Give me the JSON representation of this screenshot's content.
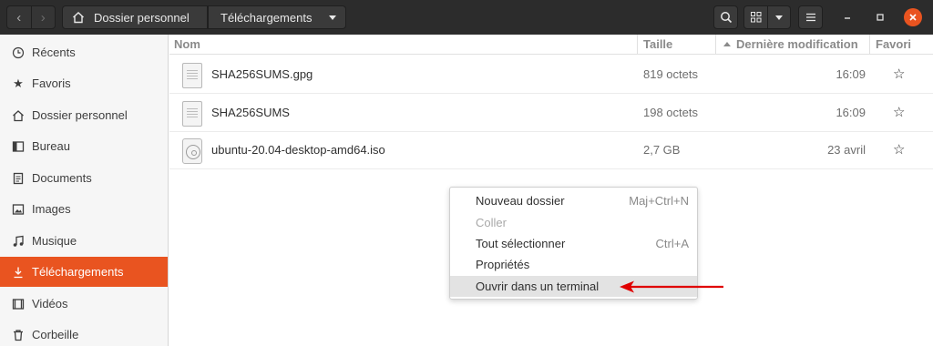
{
  "header": {
    "path_home": "Dossier personnel",
    "path_current": "Téléchargements"
  },
  "sidebar": {
    "items": [
      {
        "label": "Récents",
        "icon": "clock-icon"
      },
      {
        "label": "Favoris",
        "icon": "star-icon"
      },
      {
        "label": "Dossier personnel",
        "icon": "home-icon"
      },
      {
        "label": "Bureau",
        "icon": "desktop-icon"
      },
      {
        "label": "Documents",
        "icon": "document-icon"
      },
      {
        "label": "Images",
        "icon": "image-icon"
      },
      {
        "label": "Musique",
        "icon": "music-icon"
      },
      {
        "label": "Téléchargements",
        "icon": "download-icon"
      },
      {
        "label": "Vidéos",
        "icon": "video-icon"
      },
      {
        "label": "Corbeille",
        "icon": "trash-icon"
      }
    ],
    "active": "Téléchargements"
  },
  "list": {
    "columns": {
      "name": "Nom",
      "size": "Taille",
      "modified": "Dernière modification",
      "favorite": "Favori"
    },
    "rows": [
      {
        "name": "SHA256SUMS.gpg",
        "size": "819 octets",
        "modified": "16:09",
        "icon": "text-file-icon"
      },
      {
        "name": "SHA256SUMS",
        "size": "198 octets",
        "modified": "16:09",
        "icon": "text-file-icon"
      },
      {
        "name": "ubuntu-20.04-desktop-amd64.iso",
        "size": "2,7 GB",
        "modified": "23 avril",
        "icon": "disc-image-icon"
      }
    ]
  },
  "context_menu": {
    "items": [
      {
        "label": "Nouveau dossier",
        "shortcut": "Maj+Ctrl+N"
      },
      {
        "label": "Coller",
        "shortcut": ""
      },
      {
        "label": "Tout sélectionner",
        "shortcut": "Ctrl+A"
      },
      {
        "label": "Propriétés",
        "shortcut": ""
      },
      {
        "label": "Ouvrir dans un terminal",
        "shortcut": ""
      }
    ]
  },
  "colors": {
    "accent": "#e95420",
    "headerbar": "#2c2c2c",
    "annotation_arrow": "#e00000"
  }
}
